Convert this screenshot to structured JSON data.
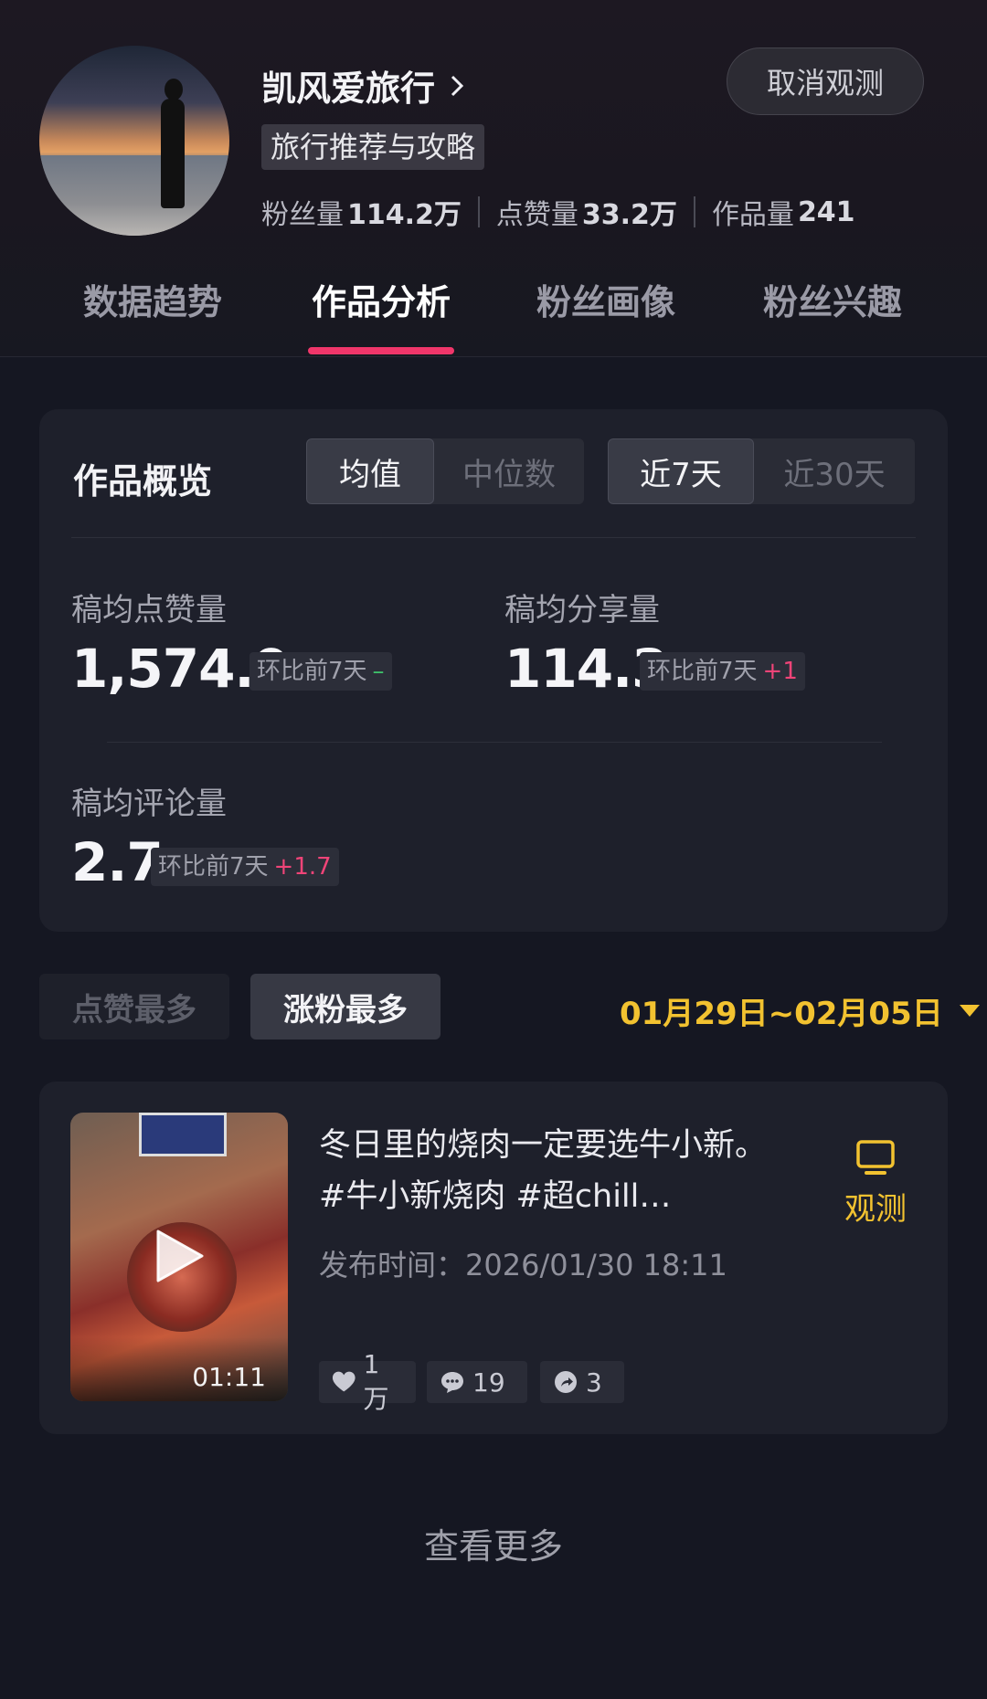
{
  "profile": {
    "name": "凯风爱旅行",
    "tag": "旅行推荐与攻略",
    "stats": [
      {
        "label": "粉丝量",
        "value": "114.2万"
      },
      {
        "label": "点赞量",
        "value": "33.2万"
      },
      {
        "label": "作品量",
        "value": "241"
      }
    ],
    "cancel_button": "取消观测"
  },
  "tabs": [
    "数据趋势",
    "作品分析",
    "粉丝画像",
    "粉丝兴趣"
  ],
  "active_tab": "作品分析",
  "overview": {
    "title": "作品概览",
    "stat_mode": [
      "均值",
      "中位数"
    ],
    "stat_mode_selected": "均值",
    "period": [
      "近7天",
      "近30天"
    ],
    "period_selected": "近7天",
    "metrics": [
      {
        "label": "稿均点赞量",
        "value": "1,574.9",
        "compare_label": "环比前7天",
        "delta": "–"
      },
      {
        "label": "稿均分享量",
        "value": "114.3",
        "compare_label": "环比前7天",
        "delta": "+1"
      },
      {
        "label": "稿均评论量",
        "value": "2.7",
        "compare_label": "环比前7天",
        "delta": "+1.7"
      }
    ]
  },
  "filters": {
    "options": [
      "点赞最多",
      "涨粉最多"
    ],
    "selected": "涨粉最多",
    "date_range": "01月29日~02月05日"
  },
  "post": {
    "title": "冬日里的烧肉一定要选牛小新。#牛小新烧肉 #超chill…",
    "publish_time": "发布时间：2026/01/30 18:11",
    "duration": "01:11",
    "likes": "1万",
    "comments": "19",
    "shares": "3",
    "observe_label": "观测"
  },
  "see_more": "查看更多",
  "colors": {
    "accent_pink": "#f0366a",
    "accent_yellow": "#f2c230",
    "delta_green": "#3ec16a",
    "delta_red": "#f04478",
    "background": "#151722",
    "card": "#1e202b"
  }
}
